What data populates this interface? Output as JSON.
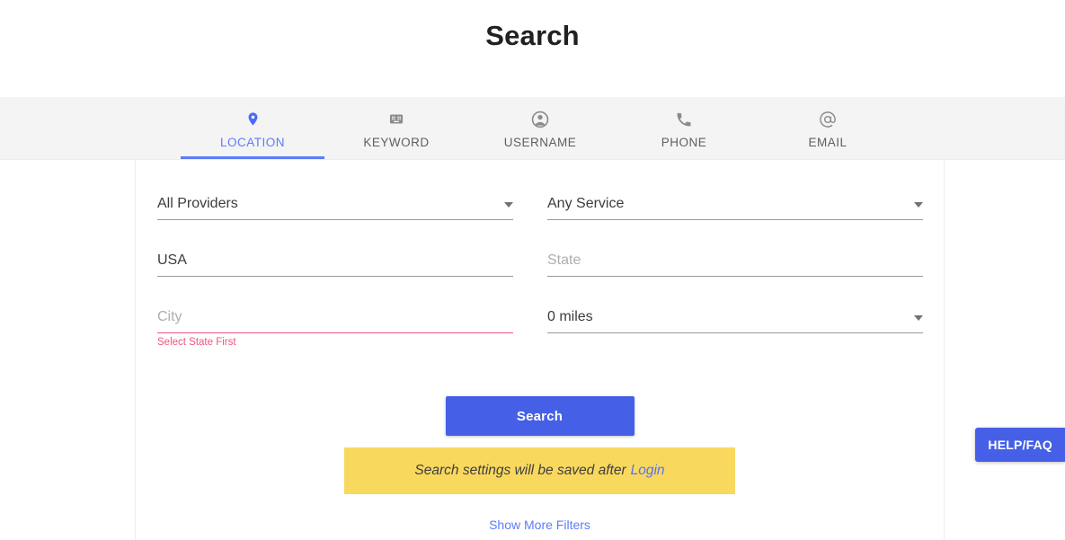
{
  "page": {
    "title": "Search"
  },
  "tabs": [
    {
      "label": "LOCATION",
      "icon": "map-pin-icon",
      "active": true
    },
    {
      "label": "KEYWORD",
      "icon": "keyboard-icon",
      "active": false
    },
    {
      "label": "USERNAME",
      "icon": "account-circle-icon",
      "active": false
    },
    {
      "label": "PHONE",
      "icon": "phone-icon",
      "active": false
    },
    {
      "label": "EMAIL",
      "icon": "at-sign-icon",
      "active": false
    }
  ],
  "form": {
    "provider": {
      "value": "All Providers",
      "is_placeholder": false,
      "has_dropdown": true
    },
    "service": {
      "value": "Any Service",
      "is_placeholder": false,
      "has_dropdown": true
    },
    "country": {
      "value": "USA",
      "is_placeholder": false,
      "has_dropdown": false
    },
    "state": {
      "value": "State",
      "is_placeholder": true,
      "has_dropdown": false
    },
    "city": {
      "value": "City",
      "is_placeholder": true,
      "has_dropdown": false,
      "error": "Select State First"
    },
    "radius": {
      "value": "0 miles",
      "is_placeholder": false,
      "has_dropdown": true
    }
  },
  "actions": {
    "search_label": "Search",
    "more_filters_label": "Show More Filters",
    "help_label": "HELP/FAQ"
  },
  "banner": {
    "text": "Search settings will be saved after",
    "link_label": "Login"
  },
  "colors": {
    "accent_blue": "#4560e6",
    "tab_active_blue": "#5c7cfa",
    "error_pink": "#f2547d",
    "banner_yellow": "#f9d85e",
    "tabbar_gray": "#f4f4f4"
  }
}
